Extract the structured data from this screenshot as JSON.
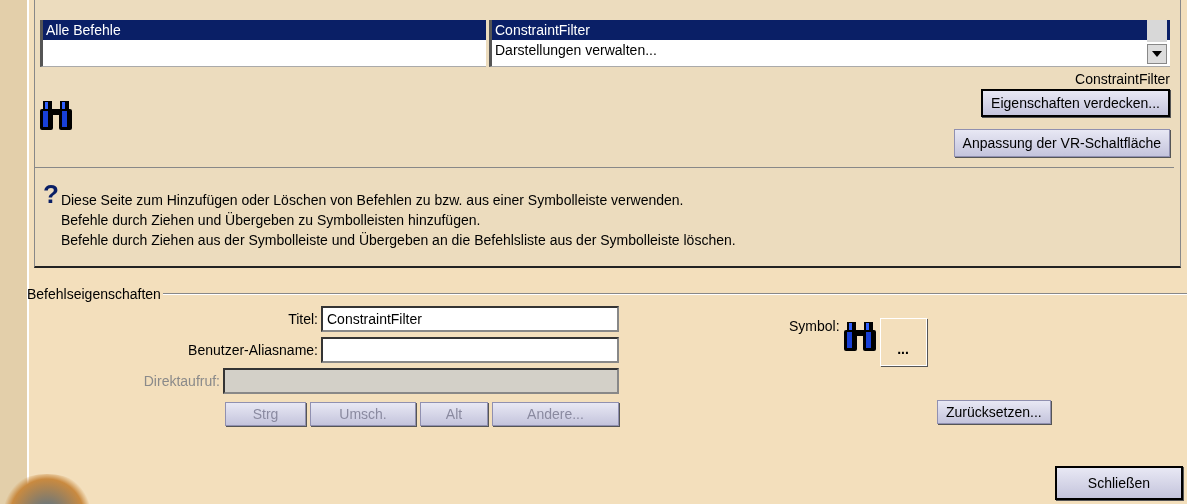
{
  "category_list": {
    "rows": [
      {
        "label": "Alle Befehle",
        "selected": true
      }
    ]
  },
  "command_list": {
    "rows": [
      {
        "label": "ConstraintFilter",
        "selected": true
      },
      {
        "label": "Darstellungen verwalten...",
        "selected": false
      }
    ]
  },
  "selected_command": "ConstraintFilter",
  "command_buttons": [
    {
      "label": "Eigenschaften verdecken...",
      "focused": true
    },
    {
      "label": "Anpassung der VR-Schaltfläche",
      "focused": false
    }
  ],
  "help": {
    "icon": "?",
    "lines": [
      "Diese Seite zum Hinzufügen oder Löschen von Befehlen zu bzw. aus einer Symbolleiste verwenden.",
      "Befehle durch Ziehen und Übergeben zu Symbolleisten hinzufügen.",
      "Befehle durch Ziehen aus der Symbolleiste und Übergeben an die Befehlsliste aus der Symbolleiste löschen."
    ]
  },
  "properties": {
    "title": "Befehlseigenschaften",
    "fields": [
      {
        "label": "Titel:",
        "value": "ConstraintFilter",
        "disabled": false
      },
      {
        "label": "Benutzer-Aliasname:",
        "disabled": false
      },
      {
        "label": "Direktaufruf:",
        "disabled": true
      }
    ],
    "modifier_keys": [
      {
        "label": "Strg",
        "disabled": true
      },
      {
        "label": "Umsch.",
        "disabled": true
      },
      {
        "label": "Alt",
        "disabled": true
      },
      {
        "label": "Andere...",
        "disabled": true
      }
    ],
    "symbol_label": "Symbol:",
    "symbol_button": "...",
    "reset_button": "Zurücksetzen..."
  },
  "close_button": {
    "label": "Schließen",
    "focused": true
  }
}
